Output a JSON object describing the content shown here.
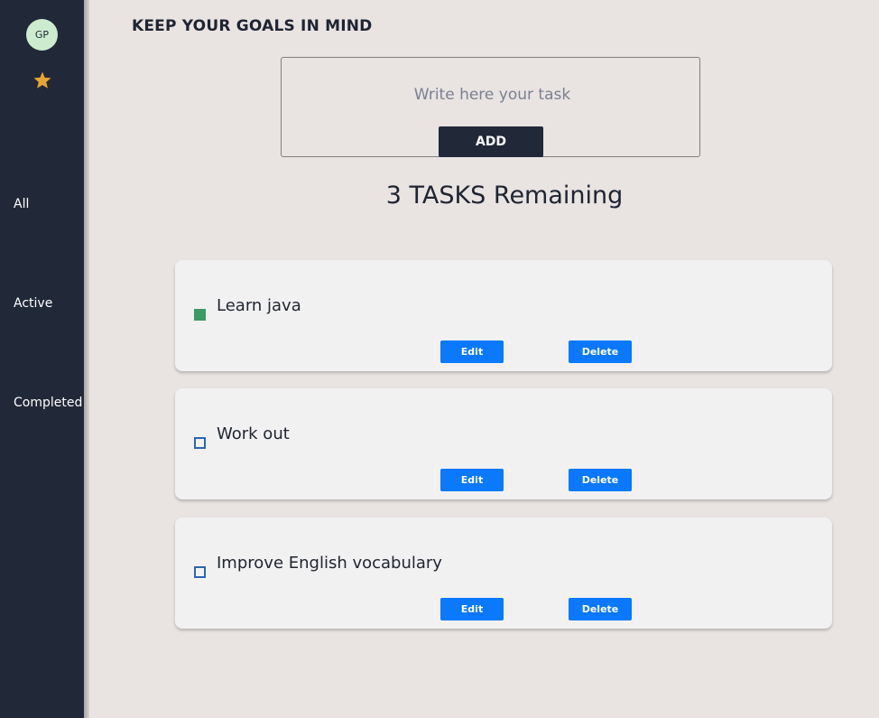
{
  "colors": {
    "sidebar_bg": "#212838",
    "page_bg": "#e9e3e2",
    "card_bg": "#f2f1f1",
    "button_blue": "#0a78ff",
    "completed_check": "#3d9a66",
    "open_check_border": "#2b66b3",
    "avatar_bg": "#cdeccf",
    "star": "#e9a534"
  },
  "sidebar": {
    "avatar_initials": "GP",
    "star_icon": "star-icon",
    "nav": [
      {
        "label": "All"
      },
      {
        "label": "Active"
      },
      {
        "label": "Completed"
      }
    ]
  },
  "header": {
    "title": "KEEP YOUR GOALS IN MIND"
  },
  "task_form": {
    "placeholder": "Write here your task",
    "value": "",
    "add_label": "ADD"
  },
  "remaining": {
    "text": "3 TASKS Remaining"
  },
  "tasks": [
    {
      "text": "Learn java",
      "completed": true,
      "edit_label": "Edit",
      "delete_label": "Delete"
    },
    {
      "text": "Work out",
      "completed": false,
      "edit_label": "Edit",
      "delete_label": "Delete"
    },
    {
      "text": "Improve English vocabulary",
      "completed": false,
      "edit_label": "Edit",
      "delete_label": "Delete"
    }
  ]
}
